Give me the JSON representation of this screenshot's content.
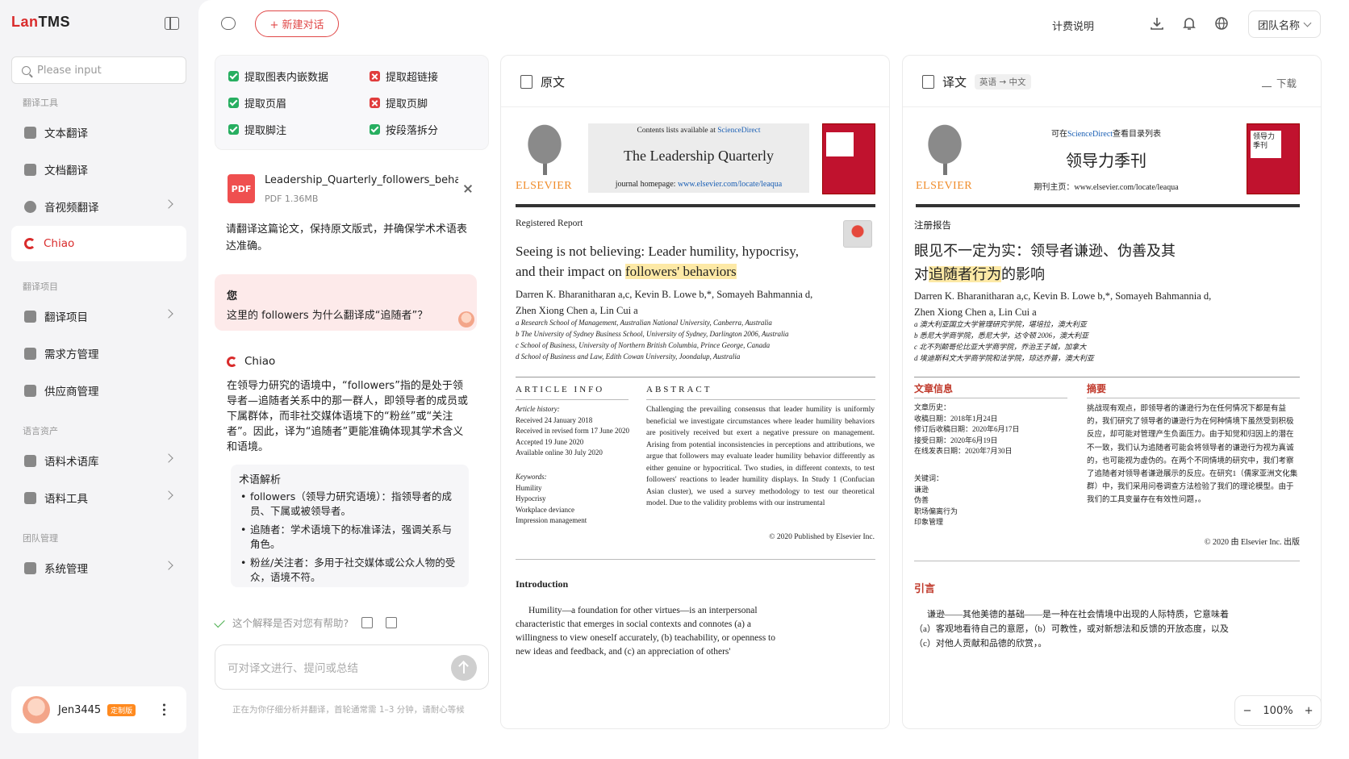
{
  "app": {
    "logo_prefix": "Lan",
    "logo_suffix": "TMS"
  },
  "sidebar": {
    "search_placeholder": "Please input",
    "sections": {
      "tools": "翻译工具",
      "projects": "翻译项目",
      "assets": "语言资产",
      "team": "团队管理"
    },
    "items": [
      {
        "label": "文本翻译"
      },
      {
        "label": "文档翻译"
      },
      {
        "label": "音视频翻译"
      },
      {
        "label": "Chiao"
      },
      {
        "label": "翻译项目"
      },
      {
        "label": "需求方管理"
      },
      {
        "label": "供应商管理"
      },
      {
        "label": "语料术语库"
      },
      {
        "label": "语料工具"
      },
      {
        "label": "系统管理"
      }
    ],
    "user": {
      "name": "Jen3445",
      "badge": "定制版"
    }
  },
  "topbar": {
    "new_chat": "+ 新建对话",
    "pricing": "计费说明",
    "team_name": "团队名称"
  },
  "options": [
    {
      "label": "提取图表内嵌数据",
      "on": true
    },
    {
      "label": "提取超链接",
      "on": false
    },
    {
      "label": "提取页眉",
      "on": true
    },
    {
      "label": "提取页脚",
      "on": false
    },
    {
      "label": "提取脚注",
      "on": true
    },
    {
      "label": "按段落拆分",
      "on": true
    }
  ],
  "file": {
    "type": "PDF",
    "name": "Leadership_Quarterly_followers_beha...",
    "size": "PDF   1.36MB"
  },
  "chat": {
    "request": "请翻译这篇论文，保持原文版式，并确保学术术语表达准确。",
    "you_label": "您",
    "question": "这里的 followers 为什么翻译成“追随者”？",
    "bot_name": "Chiao",
    "answer": "在领导力研究的语境中，“followers”指的是处于领导者—追随者关系中的那一群人，即领导者的成员或下属群体，而非社交媒体语境下的“粉丝”或“关注者”。因此，译为“追随者”更能准确体现其学术含义和语境。",
    "term_title": "术语解析",
    "terms": [
      "followers（领导力研究语境）：指领导者的成员、下属或被领导者。",
      "追随者：学术语境下的标准译法，强调关系与角色。",
      "粉丝/关注者：多用于社交媒体或公众人物的受众，语境不符。"
    ],
    "feedback": "这个解释是否对您有帮助?",
    "input_placeholder": "可对译文进行、提问或总结",
    "hint": "正在为你仔细分析并翻译，首轮通常需 1–3 分钟，请耐心等候"
  },
  "original": {
    "title": "原文",
    "elsevier": "ELSEVIER",
    "contents_prefix": "Contents lists available at ",
    "sciencedirect": "ScienceDirect",
    "journal": "The Leadership Quarterly",
    "homepage_prefix": "journal homepage: ",
    "homepage_url": "www.elsevier.com/locate/leaqua",
    "report": "Registered Report",
    "paper_title_1": "Seeing is not believing: Leader humility, hypocrisy,",
    "paper_title_2a": "and their impact on ",
    "paper_title_2b": "followers' behaviors",
    "authors_1": "Darren K. Bharanitharan a,c, Kevin B. Lowe b,*, Somayeh Bahmannia d,",
    "authors_2": "Zhen Xiong Chen a, Lin Cui a",
    "affiliations": [
      "a Research School of Management, Australian National University, Canberra, Australia",
      "b The University of Sydney Business School, University of Sydney, Darlington 2006, Australia",
      "c School of Business, University of Northern British Columbia, Prince George, Canada",
      "d School of Business and Law, Edith Cowan University, Joondalup, Australia"
    ],
    "article_info": "ARTICLE INFO",
    "abstract_head": "ABSTRACT",
    "history": [
      "Article history:",
      "Received 24 January 2018",
      "Received in revised form 17 June 2020",
      "Accepted 19 June 2020",
      "Available online 30 July 2020"
    ],
    "keywords": [
      "Keywords:",
      "Humility",
      "Hypocrisy",
      "Workplace deviance",
      "Impression management"
    ],
    "abstract": "Challenging the prevailing consensus that leader humility is uniformly beneficial we investigate circumstances where leader humility behaviors are positively received but exert a negative pressure on management. Arising from potential inconsistencies in perceptions and attributions, we argue that followers may evaluate leader humility behavior differently as either genuine or hypocritical. Two studies, in different contexts, to test followers' reactions to leader humility displays. In Study 1 (Confucian Asian cluster), we used a survey methodology to test our theoretical model. Due to the validity problems with our instrumental",
    "copyright": "© 2020 Published by Elsevier Inc.",
    "intro_head": "Introduction",
    "intro": "Humility—a foundation for other virtues—is an interpersonal characteristic that emerges in social contexts and connotes (a) a willingness to view oneself accurately, (b) teachability, or openness to new ideas and feedback, and (c) an appreciation of others'"
  },
  "translation": {
    "title": "译文",
    "lang_pair": "英语 → 中文",
    "download": "下载",
    "elsevier": "ELSEVIER",
    "contents_prefix": "可在",
    "sciencedirect": "ScienceDirect",
    "contents_suffix": "查看目录列表",
    "journal": "领导力季刊",
    "homepage": "期刊主页：www.elsevier.com/locate/leaqua",
    "cover_text": "领导力季刊",
    "report": "注册报告",
    "paper_title_1": "眼见不一定为实：领导者谦逊、伪善及其",
    "paper_title_2a": "对",
    "paper_title_2b": "追随者行为",
    "paper_title_2c": "的影响",
    "authors_1": "Darren K. Bharanitharan a,c, Kevin B. Lowe b,*, Somayeh Bahmannia d,",
    "authors_2": "Zhen Xiong Chen a, Lin Cui a",
    "affiliations": [
      "a 澳大利亚国立大学管理研究学院，堪培拉，澳大利亚",
      "b 悉尼大学商学院，悉尼大学，达令顿 2006，澳大利亚",
      "c 北不列颠哥伦比亚大学商学院，乔治王子城，加拿大",
      "d 埃迪斯科文大学商学院和法学院，琼达乔普，澳大利亚"
    ],
    "article_info": "文章信息",
    "abstract_head": "摘要",
    "history": [
      "文章历史：",
      "收稿日期：2018年1月24日",
      "修订后收稿日期：2020年6月17日",
      "接受日期：2020年6月19日",
      "在线发表日期：2020年7月30日"
    ],
    "keywords": [
      "关键词：",
      "谦逊",
      "伪善",
      "职场偏离行为",
      "印象管理"
    ],
    "abstract": "挑战现有观点，即领导者的谦逊行为在任何情况下都是有益的，我们研究了领导者的谦逊行为在何种情境下虽然受到积极反应，却可能对管理产生负面压力。由于知觉和归因上的潜在不一致，我们认为追随者可能会将领导者的谦逊行为视为真诚的，也可能视为虚伪的。在两个不同情境的研究中，我们考察了追随者对领导者谦逊展示的反应。在研究1（儒家亚洲文化集群）中，我们采用问卷调查方法检验了我们的理论模型。由于我们的工具变量存在有效性问题，。",
    "copyright": "© 2020 由 Elsevier Inc. 出版",
    "intro_head": "引言",
    "intro": "谦逊——其他美德的基础——是一种在社会情境中出现的人际特质，它意味着（a）客观地看待自己的意愿，（b）可教性，或对新想法和反馈的开放态度，以及（c）对他人贡献和品德的欣赏，。"
  },
  "zoom": {
    "value": "100%"
  }
}
